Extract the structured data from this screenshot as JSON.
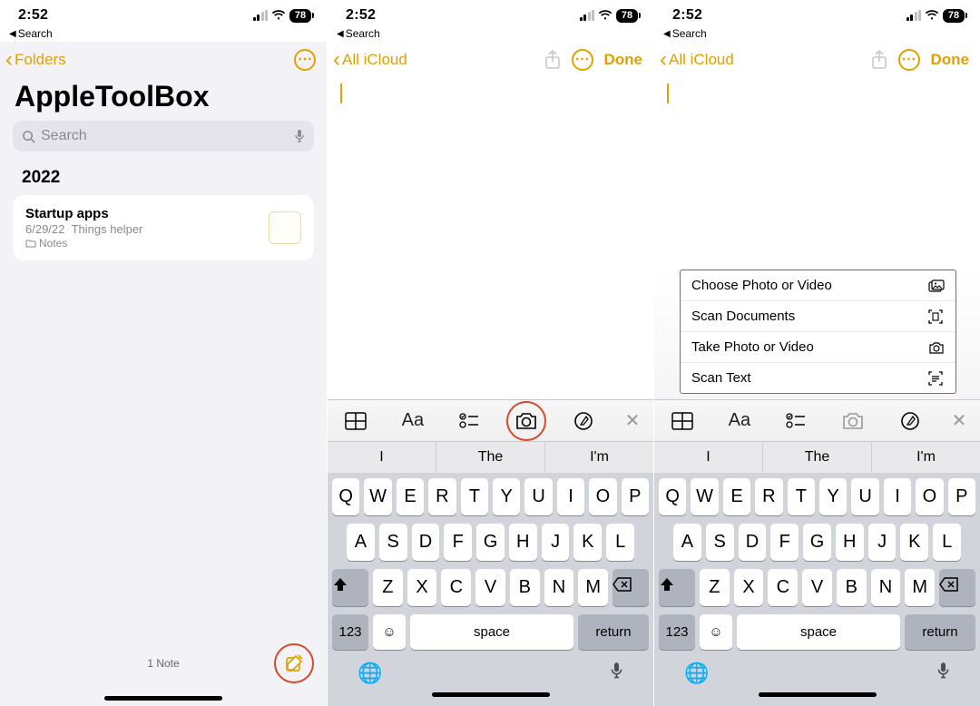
{
  "status": {
    "time": "2:52",
    "battery": "78",
    "back": "Search"
  },
  "accent": "#e1a100",
  "phone1": {
    "back_label": "Folders",
    "title": "AppleToolBox",
    "search_placeholder": "Search",
    "year": "2022",
    "note": {
      "title": "Startup apps",
      "date": "6/29/22",
      "preview": "Things helper",
      "location": "Notes"
    },
    "count": "1 Note"
  },
  "phone2": {
    "back_label": "All iCloud",
    "done": "Done",
    "suggestions": [
      "I",
      "The",
      "I'm"
    ],
    "key_123": "123",
    "key_space": "space",
    "key_return": "return"
  },
  "phone3": {
    "back_label": "All iCloud",
    "done": "Done",
    "menu": [
      "Choose Photo or Video",
      "Scan Documents",
      "Take Photo or Video",
      "Scan Text"
    ],
    "suggestions": [
      "I",
      "The",
      "I'm"
    ],
    "key_123": "123",
    "key_space": "space",
    "key_return": "return"
  },
  "keyboard": {
    "row1": [
      "Q",
      "W",
      "E",
      "R",
      "T",
      "Y",
      "U",
      "I",
      "O",
      "P"
    ],
    "row2": [
      "A",
      "S",
      "D",
      "F",
      "G",
      "H",
      "J",
      "K",
      "L"
    ],
    "row3": [
      "Z",
      "X",
      "C",
      "V",
      "B",
      "N",
      "M"
    ]
  },
  "fmt_icons": [
    "table-icon",
    "textformat-icon",
    "checklist-icon",
    "camera-icon",
    "handwrite-icon",
    "close-icon"
  ]
}
